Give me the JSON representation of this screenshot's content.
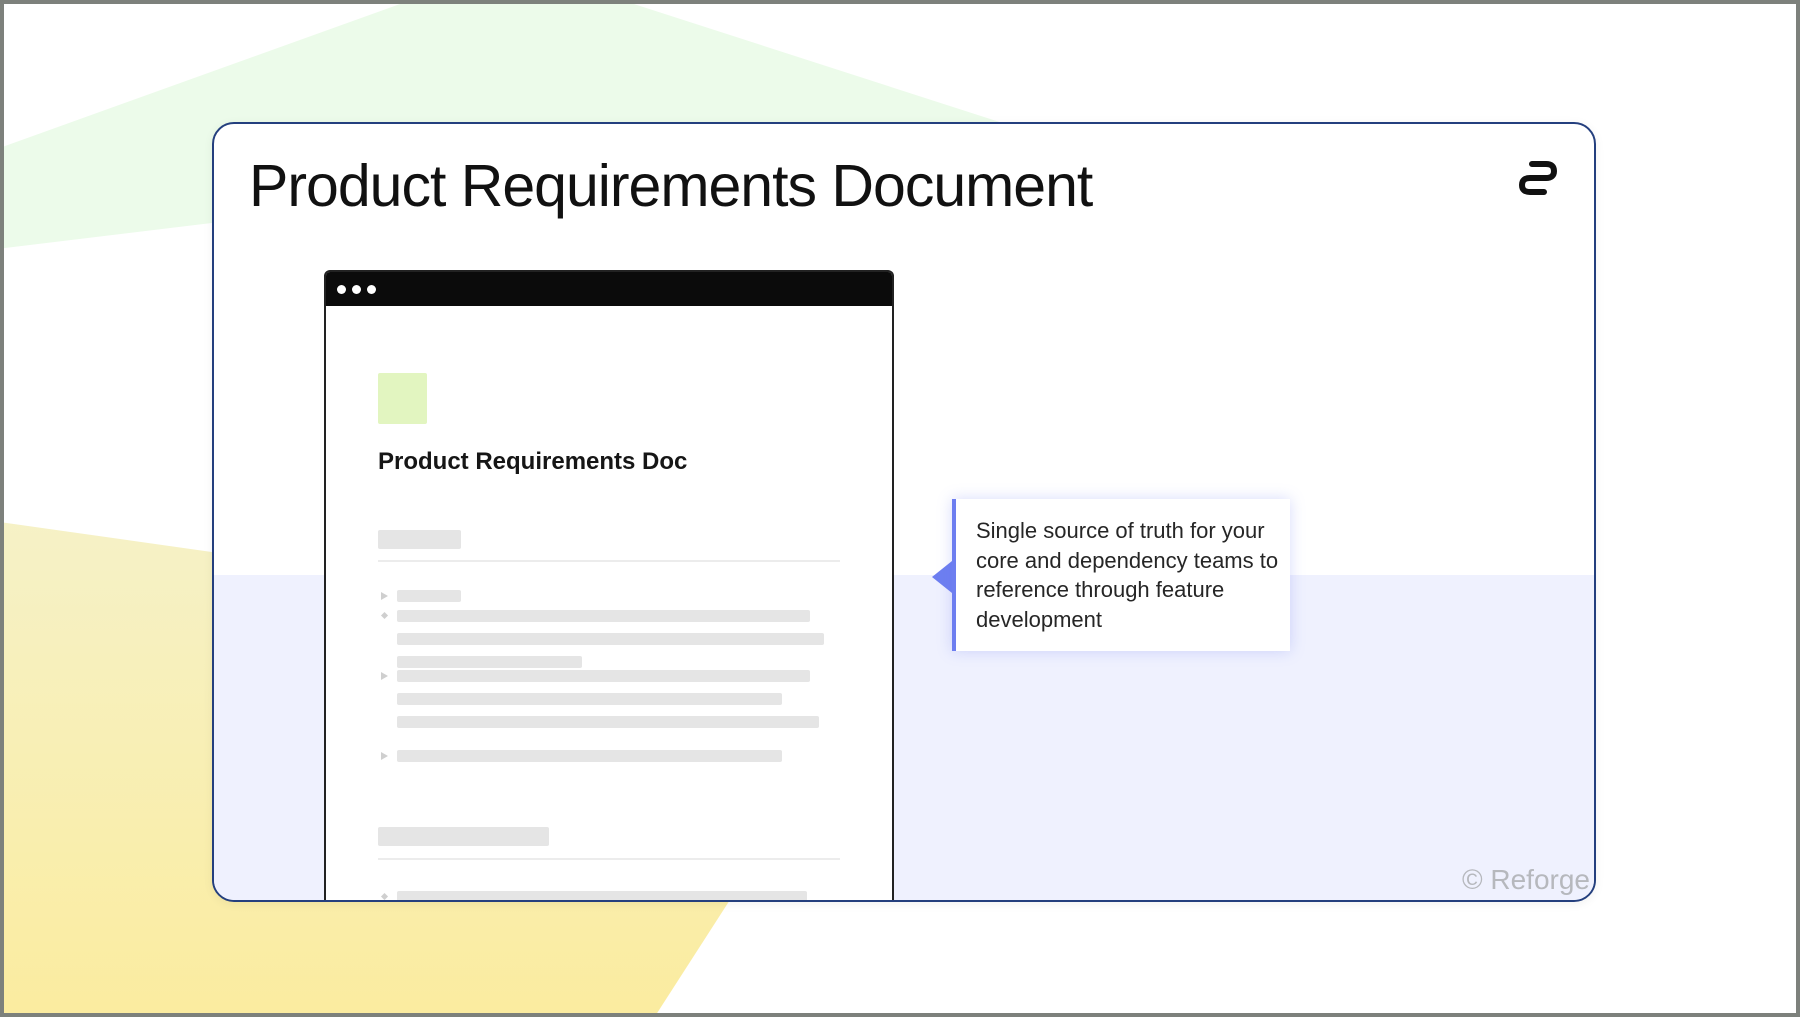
{
  "slide": {
    "title": "Product Requirements Document",
    "copyright": "© Reforge",
    "logo_icon": "reforge-logo-icon",
    "colors": {
      "card_border": "#243f7e",
      "lower_panel": "#eff1fe",
      "callout_accent": "#6d7ef0",
      "doc_swatch": "#e2f5c0",
      "bg_green": "#ecfbea",
      "bg_yellow": "#fbec9f"
    }
  },
  "document_mockup": {
    "window_controls_icon": "window-dots-icon",
    "heading": "Product Requirements Doc"
  },
  "callout": {
    "text": "Single source of truth for your core and dependency teams to reference through feature development"
  }
}
